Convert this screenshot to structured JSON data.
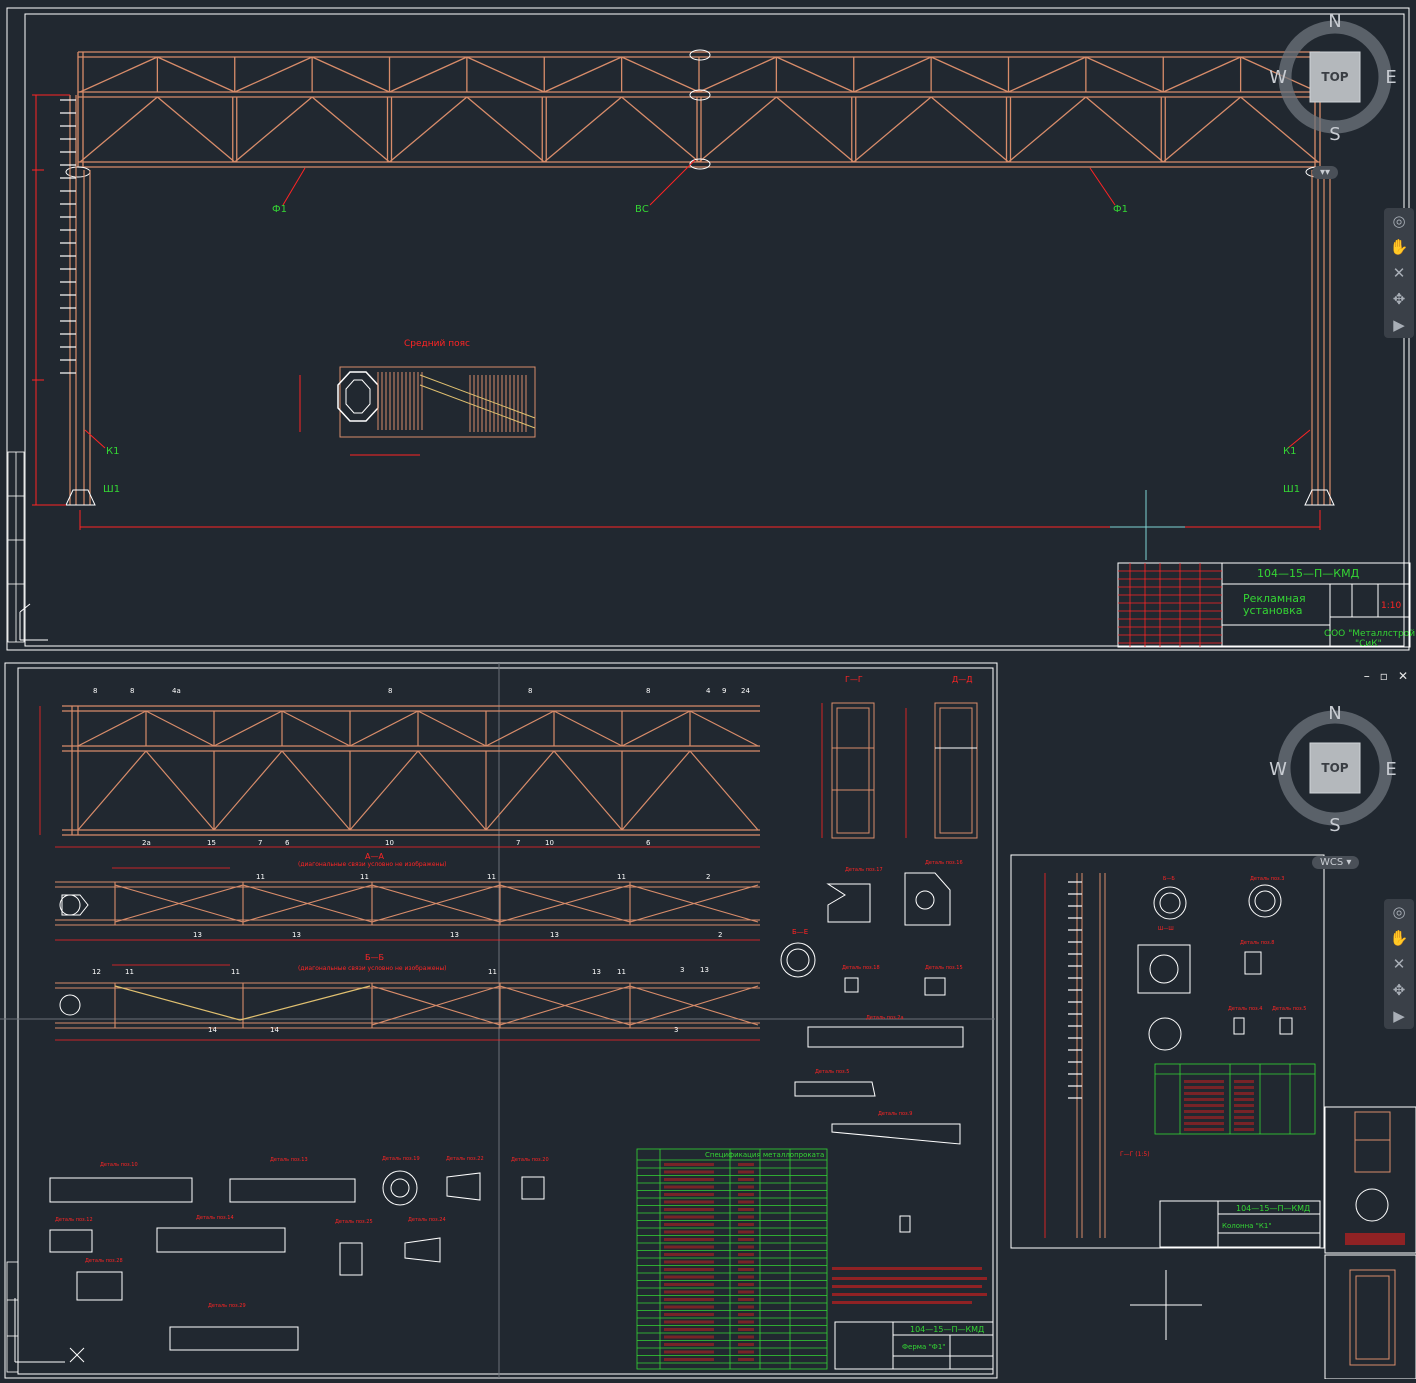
{
  "viewcube": {
    "north": "N",
    "south": "S",
    "east": "E",
    "west": "W",
    "face_label": "TOP",
    "wcs_label": "WCS"
  },
  "top_view": {
    "section_title": "Средний пояс",
    "marks": {
      "f1_left": "Ф1",
      "vs": "ВС",
      "f1_right": "Ф1",
      "k1_left": "К1",
      "k1_right": "К1",
      "sh1_left": "Ш1",
      "sh1_right": "Ш1"
    },
    "title_block": {
      "code": "104—15—П—КМД",
      "name_line1": "Рекламная",
      "name_line2": "установка",
      "scale": "1:10",
      "org_line1": "ООО \"Металлстрой",
      "org_line2": "\"СиК\""
    }
  },
  "bottom_view": {
    "section_labels": {
      "aa": "А—А",
      "aa_note": "(диагональные связи условно не изображены)",
      "bb": "Б—Б",
      "bb_note": "(диагональные связи условно не изображены)",
      "gg": "Г—Г",
      "dd": "Д—Д",
      "be": "Б—Е",
      "gp": "Г—Г (1:5)"
    },
    "part_numbers": [
      "8",
      "8",
      "4а",
      "8",
      "8",
      "8",
      "4",
      "9",
      "24",
      "2а",
      "15",
      "7",
      "6",
      "10",
      "7",
      "10",
      "6",
      "11",
      "11",
      "11",
      "11",
      "2",
      "13",
      "13",
      "13",
      "13",
      "2",
      "12",
      "11",
      "11",
      "11",
      "13",
      "11",
      "3",
      "13",
      "14",
      "14",
      "3"
    ],
    "details": [
      "Деталь поз.17",
      "Деталь поз.16",
      "Деталь поз.18",
      "Деталь поз.15",
      "Деталь поз.2а",
      "Деталь поз.5",
      "Деталь поз.9",
      "Деталь поз.10",
      "Деталь поз.13",
      "Деталь поз.19",
      "Деталь поз.22",
      "Деталь поз.20",
      "Деталь поз.12",
      "Деталь поз.14",
      "Деталь поз.25",
      "Деталь поз.24",
      "Деталь поз.28",
      "Деталь поз.29"
    ],
    "spec_title": "Спецификация металлопроката",
    "title_block_1": {
      "code": "104—15—П—КМД",
      "name": "Ферма \"Ф1\""
    },
    "title_block_2": {
      "code": "104—15—П—КМД",
      "name": "Колонна \"К1\""
    },
    "column_sheet": {
      "details": [
        "Б—Б",
        "Ш—Ш",
        "Деталь поз.3",
        "Деталь поз.8",
        "Деталь поз.4",
        "Деталь поз.5"
      ]
    }
  },
  "window_controls": {
    "minimize": "–",
    "restore": "▫",
    "close": "✕"
  },
  "navbar_icons": [
    "steeringwheel-icon",
    "pan-icon",
    "zoom-extents-icon",
    "orbit-icon",
    "showmotion-icon"
  ],
  "colors": {
    "background": "#212830",
    "truss": "#d88c6a",
    "dimension": "#ff2424",
    "text_green": "#34d634",
    "frame": "#ffffff",
    "viewcube": "#8a9098"
  }
}
